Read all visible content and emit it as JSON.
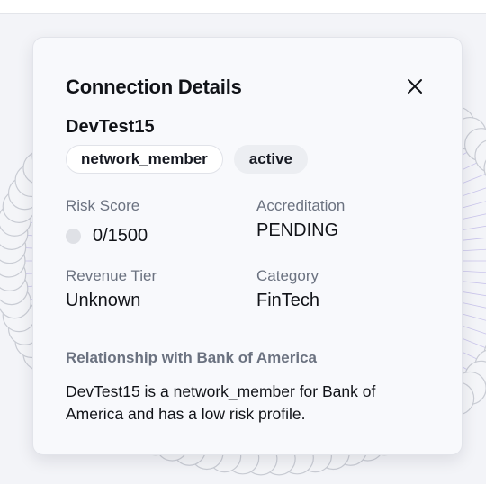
{
  "header": {
    "title": "Connection Details",
    "close_icon": "close-icon"
  },
  "entity": {
    "name": "DevTest15",
    "tags": [
      "network_member",
      "active"
    ]
  },
  "fields": {
    "risk_score": {
      "label": "Risk Score",
      "value": "0/1500",
      "indicator_color": "#dfe1e6"
    },
    "accreditation": {
      "label": "Accreditation",
      "value": "PENDING"
    },
    "revenue_tier": {
      "label": "Revenue Tier",
      "value": "Unknown"
    },
    "category": {
      "label": "Category",
      "value": "FinTech"
    }
  },
  "relationship": {
    "title": "Relationship with Bank of America",
    "text": "DevTest15 is a network_member for Bank of America and has a low risk profile."
  },
  "colors": {
    "background": "#f3f4f8",
    "card": "#f8f9fc",
    "text_primary": "#111318",
    "text_secondary": "#6b7280",
    "graph_edges": "#a89ee0"
  }
}
